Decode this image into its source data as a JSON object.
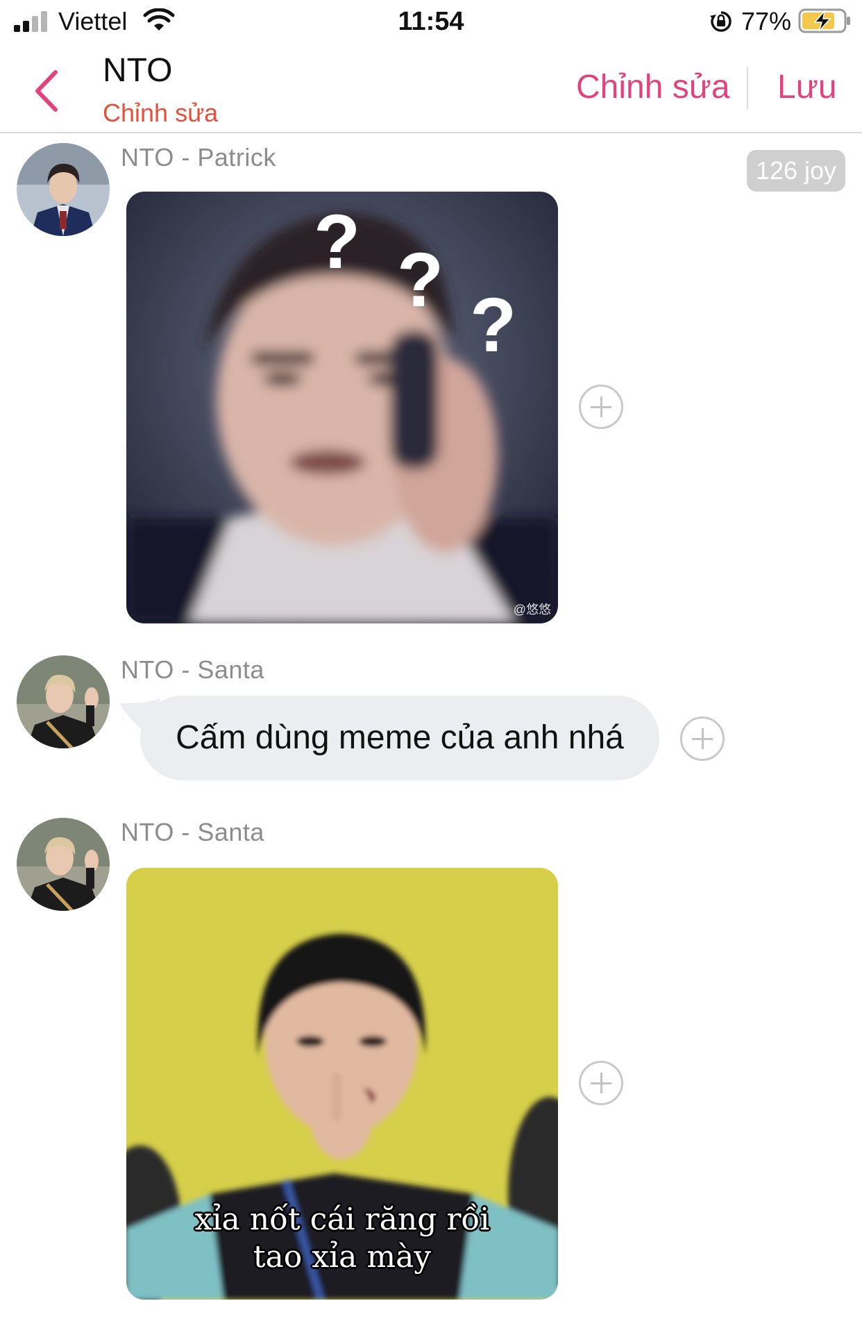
{
  "status_bar": {
    "carrier": "Viettel",
    "time": "11:54",
    "battery_percent": "77%",
    "icons": [
      "signal-icon",
      "wifi-icon",
      "rotation-lock-icon",
      "battery-charging-icon"
    ]
  },
  "nav": {
    "back_icon": "chevron-left-icon",
    "title": "NTO",
    "subtitle": "Chỉnh sửa",
    "edit_label": "Chỉnh sửa",
    "save_label": "Lưu",
    "accent_color": "#e2437f",
    "subtitle_color": "#e5503a"
  },
  "messages": [
    {
      "sender": "NTO - Patrick",
      "type": "image",
      "image_desc": "blurry-confused-face-meme",
      "watermark": "@悠悠",
      "badge": "126 joy"
    },
    {
      "sender": "NTO - Santa",
      "type": "text",
      "text": "Cấm dùng meme của anh nhá"
    },
    {
      "sender": "NTO - Santa",
      "type": "image",
      "image_desc": "boy-picking-teeth-meme",
      "caption_line1": "xỉa nốt cái răng rồi",
      "caption_line2": "tao xỉa mày"
    }
  ]
}
